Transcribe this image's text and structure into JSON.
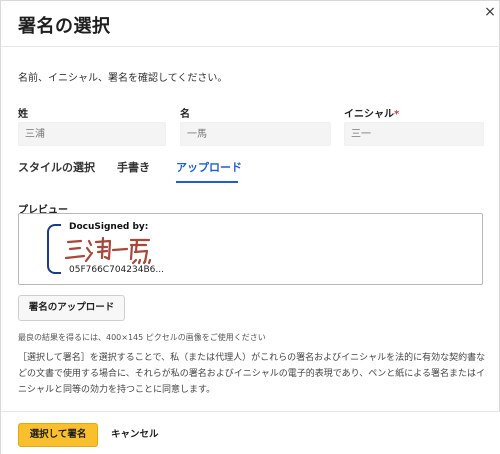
{
  "dialog": {
    "title": "署名の選択",
    "close_icon": "×",
    "instructions": "名前、イニシャル、署名を確認してください。"
  },
  "fields": {
    "last_name_label": "姓",
    "last_name_value": "三浦",
    "first_name_label": "名",
    "first_name_value": "一馬",
    "initials_label": "イニシャル",
    "initials_required": "*",
    "initials_value": "三一"
  },
  "tabs": {
    "style": "スタイルの選択",
    "draw": "手書き",
    "upload": "アップロード",
    "active": "upload"
  },
  "preview": {
    "label": "プレビュー",
    "docusigned_by": "DocuSigned by:",
    "envelope_id": "05F766C704234B6..."
  },
  "upload_button": "署名のアップロード",
  "hint": "最良の結果を得るには、400×145 ピクセルの画像をご使用ください",
  "legal_text": "［選択して署名］を選択することで、私（または代理人）がこれらの署名およびイニシャルを法的に有効な契約書などの文書で使用する場合に、それらが私の署名およびイニシャルの電子的表現であり、ペンと紙による署名またはイニシャルと同等の効力を持つことに同意します。",
  "footer": {
    "primary": "選択して署名",
    "cancel": "キャンセル"
  },
  "colors": {
    "accent": "#1a5fd6",
    "primary_button": "#f9bf2c",
    "signature_ink": "#a8473a",
    "bracket": "#1c3a86",
    "required": "#d63a3a"
  }
}
